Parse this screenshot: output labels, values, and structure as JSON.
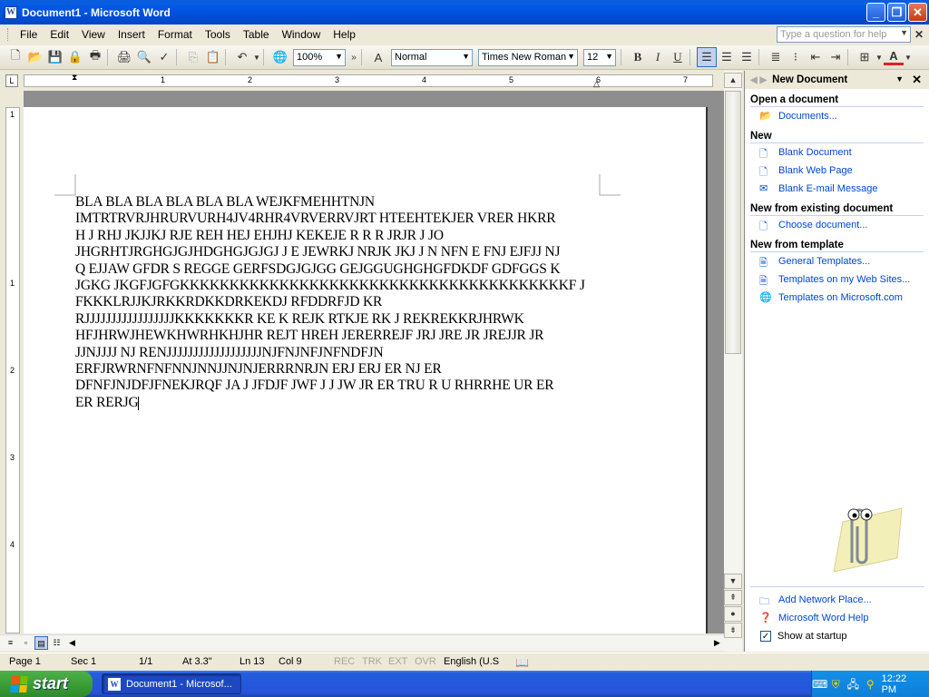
{
  "window": {
    "title": "Document1 - Microsoft Word"
  },
  "menu": [
    "File",
    "Edit",
    "View",
    "Insert",
    "Format",
    "Tools",
    "Table",
    "Window",
    "Help"
  ],
  "help_box": {
    "placeholder": "Type a question for help"
  },
  "toolbar": {
    "zoom": "100%",
    "style": "Normal",
    "font": "Times New Roman",
    "size": "12"
  },
  "ruler": {
    "h_numbers": [
      "1",
      "2",
      "3",
      "4",
      "5",
      "6",
      "7"
    ],
    "v_numbers": [
      "1",
      "1",
      "2",
      "3",
      "4"
    ]
  },
  "document": {
    "lines": [
      "BLA BLA BLA BLA BLA BLA WEJKFMEHHTNJN",
      "IMTRTRVRJHRURVURH4JV4RHR4VRVERRVJRT HTEEHTEKJER VRER HKRR",
      "H J RHJ JKJJKJ  RJE REH HEJ EHJHJ KEKEJE R R R JRJR  J JO",
      "JHGRHTJRGHGJGJHDGHGJGJGJ  J E JEWRKJ NRJK JKJ J N NFN E FNJ EJFJJ NJ",
      "Q EJJAW  GFDR S REGGE GERFSDGJGJGG   GEJGGUGHGHGFDKDF GDFGGS K",
      "JGKG JKGFJGFGKKKKKKKKKKKKKKKKKKKKKKKKKKKKKKKKKKKKKKKF J",
      "FKKKLRJJKJRKKRDKKDRKEKDJ RFDDRFJD KR",
      "RJJJJJJJJJJJJJJJJJKKKKKKKR KE  K REJK  RTKJE RK J REKREKKRJHRWK",
      "HFJHRWJHEWKHWRHKHJHR REJT HREH JERERREJF JRJ JRE JR JREJJR JR",
      "JJNJJJJ NJ RENJJJJJJJJJJJJJJJJJJNJFNJNFJNFNDFJN",
      "ERFJRWRNFNFNNJNNJJNJNJERRRNRJN ERJ ERJ ER NJ ER",
      "DFNFJNJDFJFNEKJRQF JA J JFDJF JWF J J   JW JR ER  TRU R U RHRRHE UR ER",
      "ER RERJG"
    ]
  },
  "status": {
    "page": "Page 1",
    "sec": "Sec 1",
    "pages": "1/1",
    "at": "At 3.3\"",
    "ln": "Ln 13",
    "col": "Col 9",
    "rec": "REC",
    "trk": "TRK",
    "ext": "EXT",
    "ovr": "OVR",
    "lang": "English (U.S"
  },
  "taskpane": {
    "title": "New Document",
    "open_header": "Open a document",
    "documents_link": "Documents...",
    "new_header": "New",
    "new_links": [
      "Blank Document",
      "Blank Web Page",
      "Blank E-mail Message"
    ],
    "existing_header": "New from existing document",
    "choose_link": "Choose document...",
    "template_header": "New from template",
    "template_links": [
      "General Templates...",
      "Templates on my Web Sites...",
      "Templates on Microsoft.com"
    ],
    "bottom_links": [
      "Add Network Place...",
      "Microsoft Word Help"
    ],
    "show_startup": "Show at startup"
  },
  "taskbar": {
    "start": "start",
    "item": "Document1 - Microsof...",
    "clock": "12:22 PM"
  },
  "colors": {
    "title_blue": "#0055E5",
    "start_green": "#3C9F37",
    "link_blue": "#0046D5",
    "font_color_red": "#E02020"
  }
}
